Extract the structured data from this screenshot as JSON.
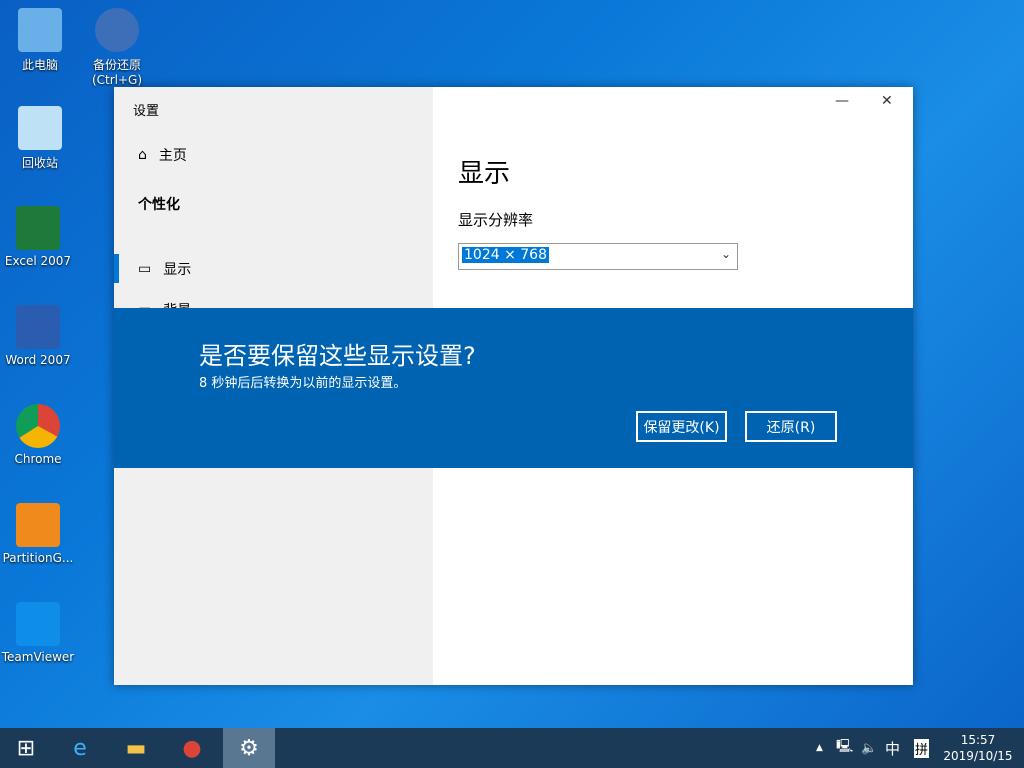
{
  "desktop": {
    "icons": [
      {
        "label": "此电脑",
        "color": "#6ab0e8"
      },
      {
        "label": "备份还原\n(Ctrl+G)",
        "color": "#3d6fb8"
      },
      {
        "label": "回收站",
        "color": "#bfe1f5"
      },
      {
        "label": "Excel 2007",
        "color": "#1e7a3a"
      },
      {
        "label": "Word 2007",
        "color": "#2a5db0"
      },
      {
        "label": "Chrome",
        "color": "#db4437"
      },
      {
        "label": "PartitionG...",
        "color": "#f08a1c"
      },
      {
        "label": "TeamViewer",
        "color": "#0e8ee9"
      }
    ]
  },
  "window": {
    "app_title": "设置",
    "minimize": "—",
    "close": "✕",
    "sidebar": {
      "home": "主页",
      "section": "个性化",
      "items": [
        {
          "label": "显示"
        },
        {
          "label": "背景"
        }
      ]
    },
    "main": {
      "title": "显示",
      "resolution_label": "显示分辨率",
      "resolution_value": "1024 × 768"
    }
  },
  "dialog": {
    "title": "是否要保留这些显示设置?",
    "message": "8 秒钟后后转换为以前的显示设置。",
    "keep_button": "保留更改(K)",
    "revert_button": "还原(R)"
  },
  "taskbar": {
    "time": "15:57",
    "date": "2019/10/15",
    "ime": "中",
    "ime_mode": "拼",
    "accent": "#0078d7"
  }
}
